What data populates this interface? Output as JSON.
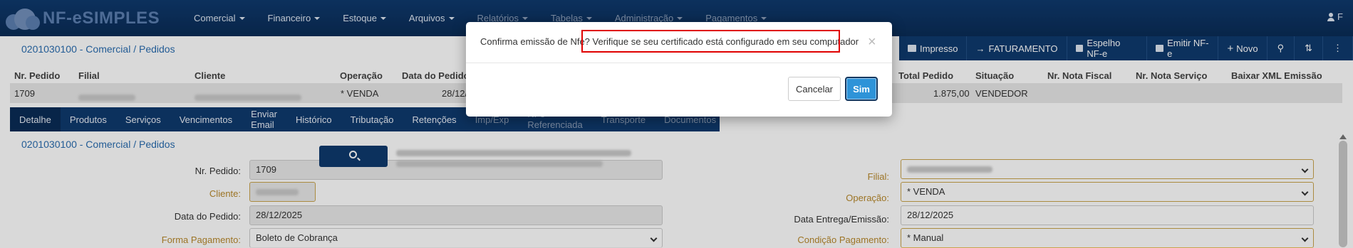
{
  "app": {
    "logo_text": "NF-eSIMPLES",
    "user_initial": "F"
  },
  "nav": {
    "items": [
      {
        "label": "Comercial"
      },
      {
        "label": "Financeiro"
      },
      {
        "label": "Estoque"
      },
      {
        "label": "Arquivos"
      },
      {
        "label": "Relatórios"
      },
      {
        "label": "Tabelas"
      },
      {
        "label": "Administração"
      },
      {
        "label": "Pagamentos"
      }
    ]
  },
  "page": {
    "title": "0201030100 - Comercial / Pedidos"
  },
  "toolbar": {
    "impresso": "Impresso",
    "faturamento": "FATURAMENTO",
    "espelho": "Espelho NF-e",
    "emitir": "Emitir NF-e",
    "novo": "Novo"
  },
  "grid": {
    "headers": {
      "nr_pedido": "Nr. Pedido",
      "filial": "Filial",
      "cliente": "Cliente",
      "operacao": "Operação",
      "data_pedido": "Data do Pedido",
      "total_pedido": "Total Pedido",
      "situacao": "Situação",
      "nr_nota_fiscal": "Nr. Nota Fiscal",
      "nr_nota_servico": "Nr. Nota Serviço",
      "baixar_xml": "Baixar XML Emissão"
    },
    "row": {
      "nr_pedido": "1709",
      "operacao": "* VENDA",
      "data_pedido": "28/12/",
      "total_pedido": "1.875,00",
      "situacao": "VENDEDOR"
    }
  },
  "tabs": [
    {
      "label": "Detalhe"
    },
    {
      "label": "Produtos"
    },
    {
      "label": "Serviços"
    },
    {
      "label": "Vencimentos"
    },
    {
      "label": "Enviar Email"
    },
    {
      "label": "Histórico"
    },
    {
      "label": "Tributação"
    },
    {
      "label": "Retenções"
    },
    {
      "label": "Imp/Exp"
    },
    {
      "label": "NFe Referenciada"
    },
    {
      "label": "Transporte"
    },
    {
      "label": "Documentos"
    }
  ],
  "form": {
    "section_title": "0201030100 - Comercial / Pedidos",
    "nr_pedido_label": "Nr. Pedido:",
    "nr_pedido_value": "1709",
    "cliente_label": "Cliente:",
    "data_pedido_label": "Data do Pedido:",
    "data_pedido_value": "28/12/2025",
    "forma_pagamento_label": "Forma Pagamento:",
    "forma_pagamento_value": "Boleto de Cobrança",
    "filial_label": "Filial:",
    "operacao_label": "Operação:",
    "operacao_value": "* VENDA",
    "data_entrega_label": "Data Entrega/Emissão:",
    "data_entrega_value": "28/12/2025",
    "condicao_pagamento_label": "Condição Pagamento:",
    "condicao_pagamento_value": "* Manual"
  },
  "modal": {
    "message_start": "Confirma emissão de Nfe? ",
    "message_highlight": "Verifique se seu certificado está configurado em seu computador",
    "close": "×",
    "cancel_label": "Cancelar",
    "confirm_label": "Sim"
  }
}
